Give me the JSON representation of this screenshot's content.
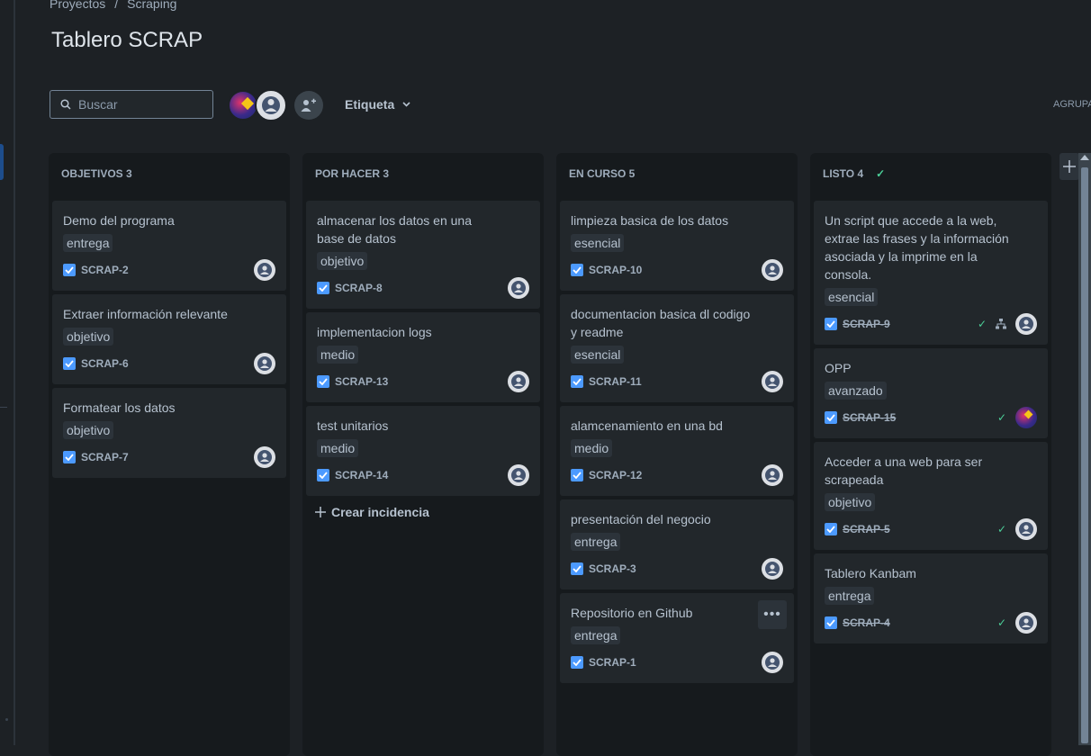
{
  "breadcrumb": {
    "items": [
      "Proyectos",
      "Scraping"
    ],
    "separator": "/"
  },
  "page": {
    "title": "Tablero SCRAP"
  },
  "toolbar": {
    "search_placeholder": "Buscar",
    "filter_label": "Etiqueta",
    "group_label": "AGRUPA"
  },
  "columns": [
    {
      "header": "OBJETIVOS 3",
      "cards": [
        {
          "title": "Demo del programa",
          "label": "entrega",
          "key": "SCRAP-2"
        },
        {
          "title": "Extraer información relevante",
          "label": "objetivo",
          "key": "SCRAP-6"
        },
        {
          "title": "Formatear los datos",
          "label": "objetivo",
          "key": "SCRAP-7"
        }
      ]
    },
    {
      "header": "POR HACER 3",
      "cards": [
        {
          "title": "almacenar los datos en una base de datos",
          "label": "objetivo",
          "key": "SCRAP-8"
        },
        {
          "title": "implementacion logs",
          "label": "medio",
          "key": "SCRAP-13"
        },
        {
          "title": "test unitarios",
          "label": "medio",
          "key": "SCRAP-14"
        }
      ],
      "create_label": "Crear incidencia"
    },
    {
      "header": "EN CURSO 5",
      "cards": [
        {
          "title": "limpieza basica de los datos",
          "label": "esencial",
          "key": "SCRAP-10"
        },
        {
          "title": "documentacion basica dl codigo y readme",
          "label": "esencial",
          "key": "SCRAP-11"
        },
        {
          "title": "alamcenamiento en una bd",
          "label": "medio",
          "key": "SCRAP-12"
        },
        {
          "title": "presentación del negocio",
          "label": "entrega",
          "key": "SCRAP-3"
        },
        {
          "title": "Repositorio en Github",
          "label": "entrega",
          "key": "SCRAP-1"
        }
      ]
    },
    {
      "header": "LISTO 4",
      "cards": [
        {
          "title": "Un script que accede a la web, extrae las frases y la información asociada y la imprime en la consola.",
          "label": "esencial",
          "key": "SCRAP-9"
        },
        {
          "title": "OPP",
          "label": "avanzado",
          "key": "SCRAP-15"
        },
        {
          "title": "Acceder a una web para ser scrapeada",
          "label": "objetivo",
          "key": "SCRAP-5"
        },
        {
          "title": "Tablero Kanbam",
          "label": "entrega",
          "key": "SCRAP-4"
        }
      ]
    }
  ],
  "colors": {
    "background": "#1d2125",
    "column": "#161a1d",
    "card": "#22272b",
    "done_check": "#4bce97",
    "issue_icon": "#4c9aff"
  }
}
